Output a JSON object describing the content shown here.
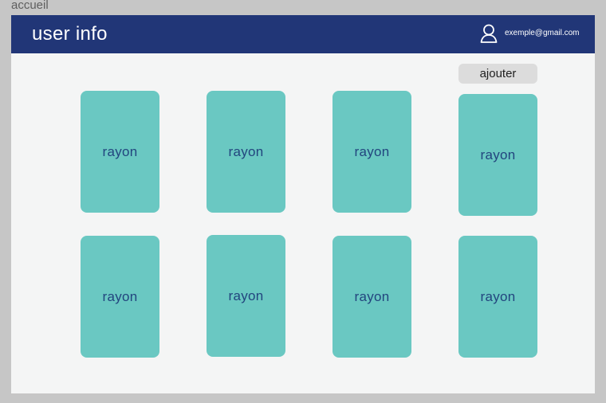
{
  "page": {
    "label": "accueil"
  },
  "header": {
    "title": "user info",
    "user_icon": "user-icon",
    "email": "exemple@gmail.com"
  },
  "actions": {
    "add_label": "ajouter"
  },
  "grid": {
    "tiles": [
      {
        "label": "rayon"
      },
      {
        "label": "rayon"
      },
      {
        "label": "rayon"
      },
      {
        "label": "rayon"
      },
      {
        "label": "rayon"
      },
      {
        "label": "rayon"
      },
      {
        "label": "rayon"
      },
      {
        "label": "rayon"
      }
    ]
  },
  "colors": {
    "header_bg": "#213677",
    "tile_bg": "#6ac8c2",
    "tile_text": "#22457e",
    "content_bg": "#f4f5f5",
    "button_bg": "#dcdcdc"
  }
}
